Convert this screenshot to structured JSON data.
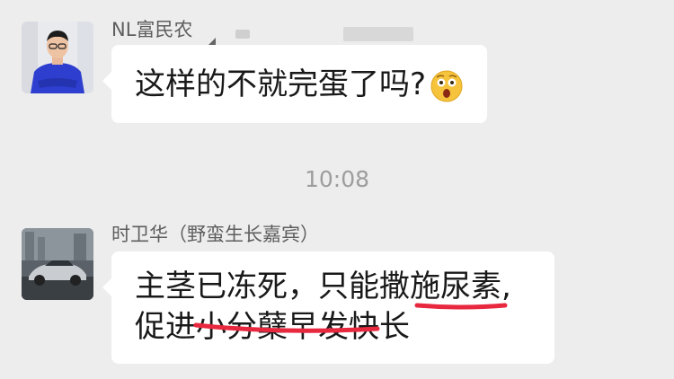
{
  "messages": [
    {
      "sender": "NL富民农",
      "text": "这样的不就完蛋了吗?",
      "emoji": "shocked-face-emoji"
    },
    {
      "sender": "时卫华（野蛮生长嘉宾）",
      "lines": [
        "主茎已冻死，只能撒施尿素,",
        "促进小分蘖早发快长"
      ]
    }
  ],
  "timestamp": "10:08",
  "colors": {
    "background": "#ededed",
    "bubble": "#ffffff",
    "underline": "#e8283f"
  }
}
